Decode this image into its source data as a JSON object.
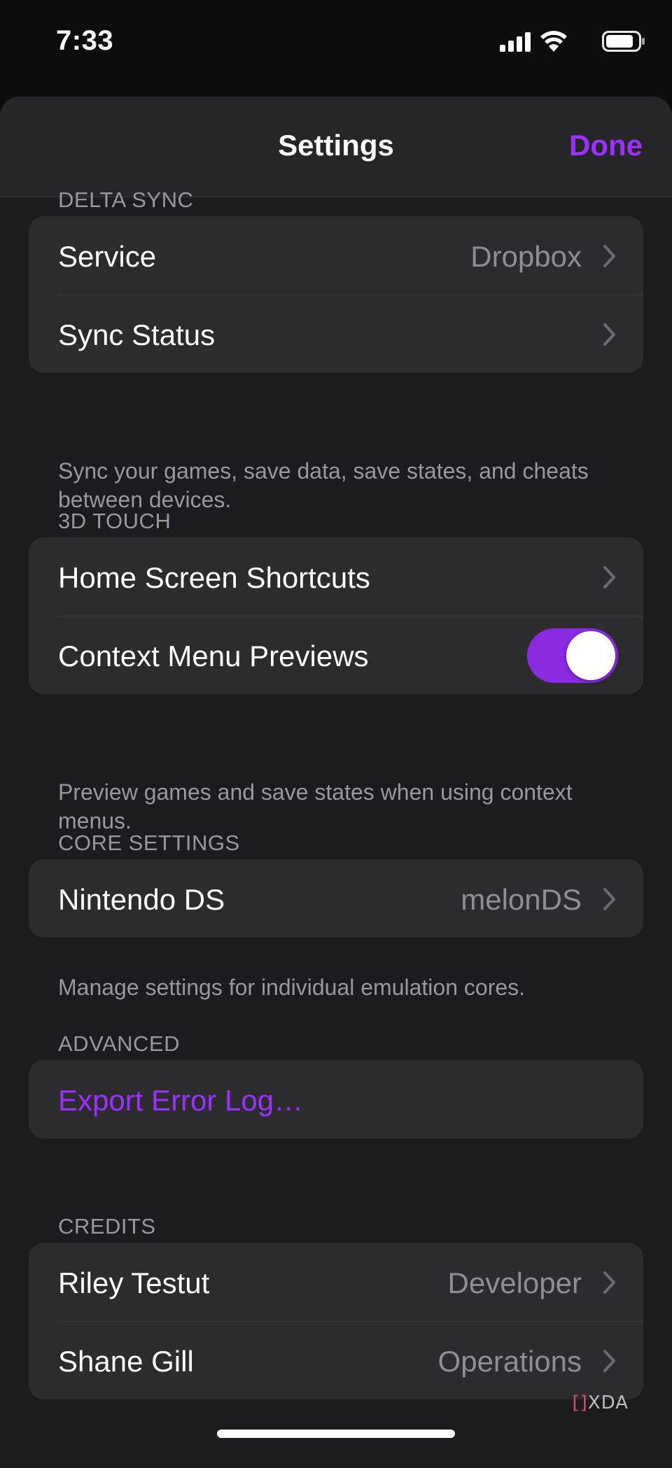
{
  "status_bar": {
    "time": "7:33"
  },
  "nav": {
    "title": "Settings",
    "done_label": "Done"
  },
  "sections": {
    "delta_sync": {
      "header": "DELTA SYNC",
      "rows": [
        {
          "label": "Service",
          "value": "Dropbox"
        },
        {
          "label": "Sync Status"
        }
      ],
      "footer": "Sync your games, save data, save states, and cheats between devices."
    },
    "touch_3d": {
      "header": "3D TOUCH",
      "rows": [
        {
          "label": "Home Screen Shortcuts"
        },
        {
          "label": "Context Menu Previews",
          "toggle_on": true
        }
      ],
      "footer": "Preview games and save states when using context menus."
    },
    "core_settings": {
      "header": "CORE SETTINGS",
      "rows": [
        {
          "label": "Nintendo DS",
          "value": "melonDS"
        }
      ],
      "footer": "Manage settings for individual emulation cores."
    },
    "advanced": {
      "header": "ADVANCED",
      "rows": [
        {
          "label": "Export Error Log…"
        }
      ]
    },
    "credits": {
      "header": "CREDITS",
      "rows": [
        {
          "label": "Riley Testut",
          "value": "Developer"
        },
        {
          "label": "Shane Gill",
          "value": "Operations"
        }
      ]
    }
  },
  "watermark": {
    "bracket": "[]",
    "text": "XDA"
  },
  "colors": {
    "accent": "#9b30ff",
    "toggle_on": "#8a2be2",
    "background": "#1c1c1e",
    "cell": "#2c2c2e",
    "secondary_text": "#98989e"
  },
  "icons": [
    "signal-bars-icon",
    "wifi-icon",
    "battery-icon",
    "chevron-right-icon"
  ]
}
